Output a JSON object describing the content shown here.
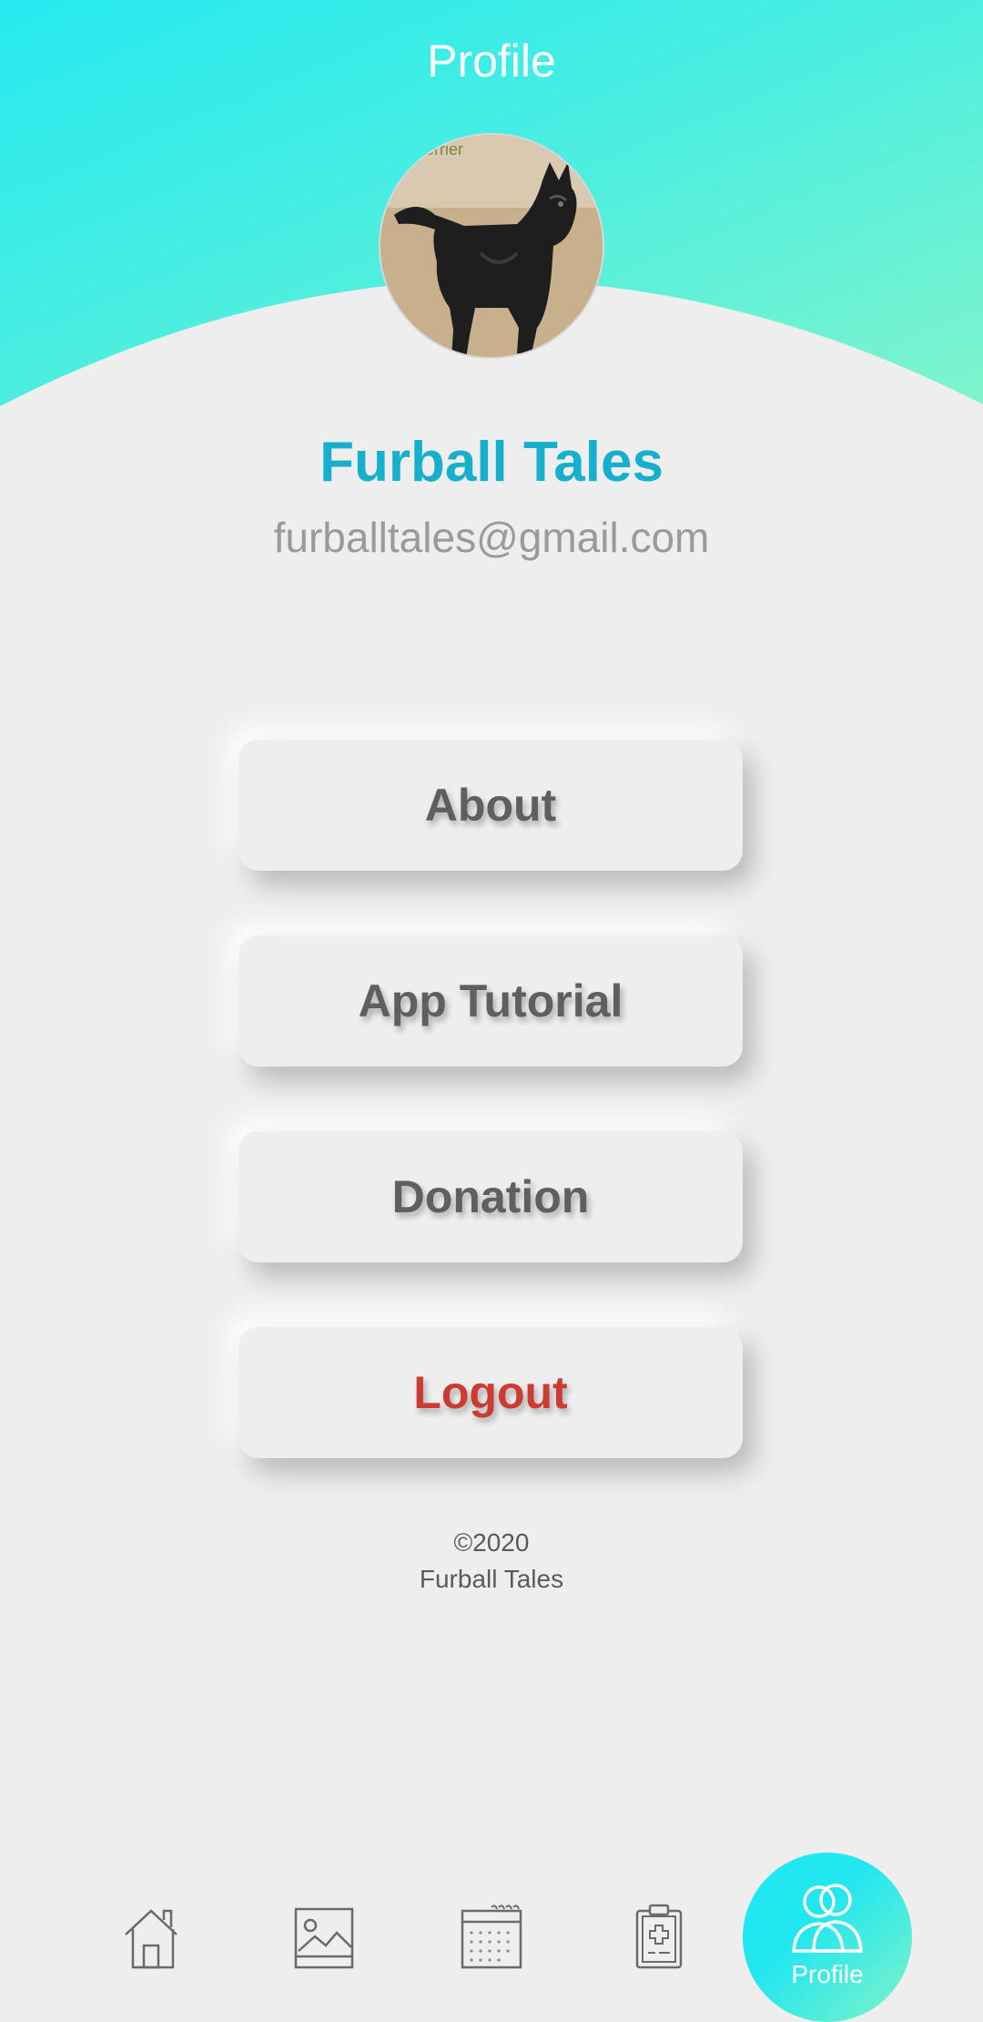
{
  "header": {
    "title": "Profile"
  },
  "profile": {
    "name": "Furball Tales",
    "email": "furballtales@gmail.com",
    "avatar_icon": "terrier-dog-photo",
    "avatar_caption": "Terrier"
  },
  "menu": {
    "about_label": "About",
    "tutorial_label": "App Tutorial",
    "donation_label": "Donation",
    "logout_label": "Logout"
  },
  "footer": {
    "copyright": "©2020",
    "brand": "Furball Tales"
  },
  "bottom_nav": {
    "items": [
      {
        "icon": "home-icon"
      },
      {
        "icon": "gallery-icon"
      },
      {
        "icon": "calendar-icon"
      },
      {
        "icon": "medical-clipboard-icon"
      },
      {
        "icon": "profile-icon",
        "label": "Profile",
        "active": true
      }
    ]
  },
  "colors": {
    "header_gradient_start": "#26e9f0",
    "header_gradient_end": "#7ff4cc",
    "name_color": "#17b0cc",
    "logout_color": "#cc3b32",
    "background": "#eeeeee"
  }
}
